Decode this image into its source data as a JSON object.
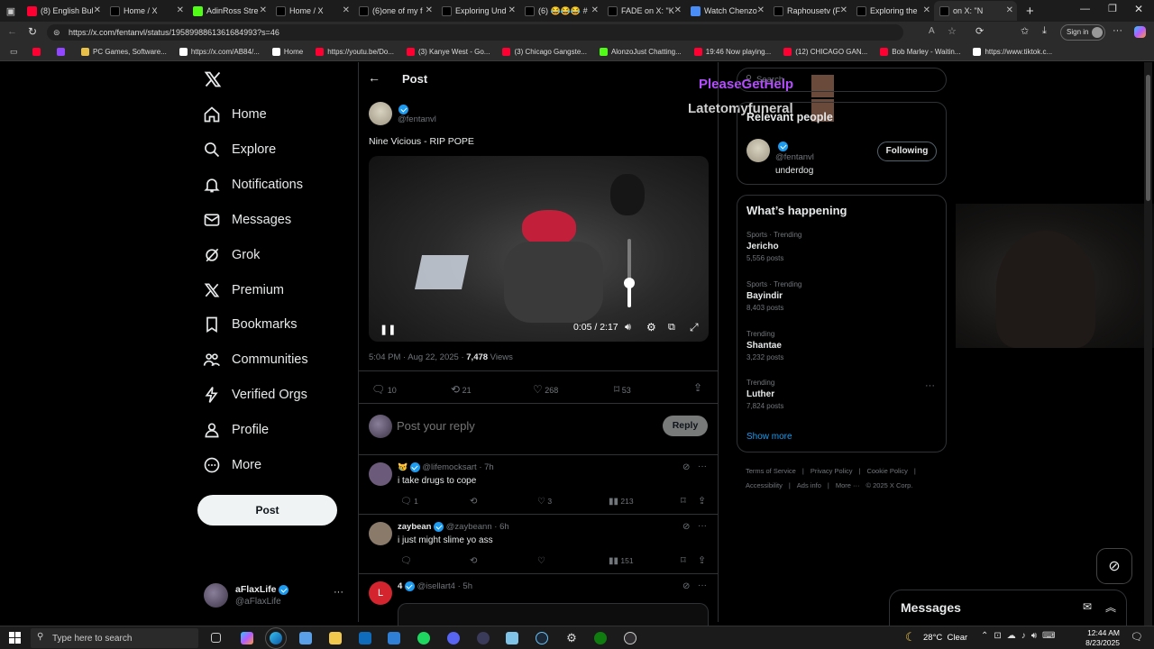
{
  "browser": {
    "tabs": [
      {
        "label": "(8) English Bul",
        "icon": "youtube-icon",
        "color": "#ff0033"
      },
      {
        "label": "Home / X",
        "icon": "x-icon",
        "color": "#ffffff"
      },
      {
        "label": "AdinRoss Stre",
        "icon": "kick-icon",
        "color": "#53fc18"
      },
      {
        "label": "Home / X",
        "icon": "x-icon",
        "color": "#ffffff"
      },
      {
        "label": "(6)one of my f",
        "icon": "tiktok-icon",
        "color": "#ffffff"
      },
      {
        "label": "Exploring Und",
        "icon": "tiktok-icon",
        "color": "#ffffff"
      },
      {
        "label": "(6) 😂😂😂 #",
        "icon": "tiktok-icon",
        "color": "#ffffff"
      },
      {
        "label": "FADE on X: \"K",
        "icon": "x-icon",
        "color": "#ffffff"
      },
      {
        "label": "Watch Chenzo",
        "icon": "globe-icon",
        "color": "#4a8df6"
      },
      {
        "label": "Raphousetv (F",
        "icon": "x-icon",
        "color": "#ffffff"
      },
      {
        "label": "Exploring the",
        "icon": "tiktok-icon",
        "color": "#ffffff"
      },
      {
        "label": "on X: \"N",
        "icon": "x-icon",
        "color": "#ffffff"
      }
    ],
    "url": "https://x.com/fentanvl/status/1958998861361684993?s=46",
    "signin": "Sign in",
    "bookmarks": [
      {
        "label": "",
        "color": "#ff0033"
      },
      {
        "label": "",
        "color": "#9146ff"
      },
      {
        "label": "PC Games, Software...",
        "color": "#e8c04a"
      },
      {
        "label": "https://x.com/AB84/...",
        "color": "#ffffff"
      },
      {
        "label": "Home",
        "color": "#ffffff"
      },
      {
        "label": "https://youtu.be/Do...",
        "color": "#ff0033"
      },
      {
        "label": "(3) Kanye West - Go...",
        "color": "#ff0033"
      },
      {
        "label": "(3) Chicago Gangste...",
        "color": "#ff0033"
      },
      {
        "label": "AlonzoJust Chatting...",
        "color": "#53fc18"
      },
      {
        "label": "19:46 Now playing...",
        "color": "#ff0033"
      },
      {
        "label": "(12) CHICAGO GAN...",
        "color": "#ff0033"
      },
      {
        "label": "Bob Marley - Waitin...",
        "color": "#ff0033"
      },
      {
        "label": "https://www.tiktok.c...",
        "color": "#ffffff"
      }
    ]
  },
  "nav": {
    "items": [
      {
        "label": "Home",
        "icon": "home-icon"
      },
      {
        "label": "Explore",
        "icon": "search-icon"
      },
      {
        "label": "Notifications",
        "icon": "bell-icon"
      },
      {
        "label": "Messages",
        "icon": "mail-icon"
      },
      {
        "label": "Grok",
        "icon": "grok-icon"
      },
      {
        "label": "Premium",
        "icon": "x-icon"
      },
      {
        "label": "Bookmarks",
        "icon": "bookmark-icon"
      },
      {
        "label": "Communities",
        "icon": "people-icon"
      },
      {
        "label": "Verified Orgs",
        "icon": "lightning-icon"
      },
      {
        "label": "Profile",
        "icon": "person-icon"
      },
      {
        "label": "More",
        "icon": "more-circle-icon"
      }
    ],
    "post_button": "Post",
    "account": {
      "name": "aFlaxLife",
      "handle": "@aFlaxLife"
    }
  },
  "post": {
    "header": "Post",
    "handle": "@fentanvl",
    "text": "Nine Vicious - RIP POPE",
    "video": {
      "time": "0:05 / 2:17",
      "volume": 0.35
    },
    "timestamp": "5:04 PM · Aug 22, 2025 · ",
    "views_count": "7,478",
    "views_label": " Views",
    "stats": {
      "replies": "10",
      "reposts": "21",
      "likes": "268",
      "bookmarks": "53"
    },
    "reply_placeholder": "Post your reply",
    "reply_button": "Reply"
  },
  "replies": [
    {
      "name": "",
      "handle": "@lifemocksart",
      "time": "· 7h",
      "text": "i take drugs to cope",
      "replies": "1",
      "reposts": "",
      "likes": "3",
      "views": "213",
      "avatar_color": "#6b5a7a",
      "initial": ""
    },
    {
      "name": "zaybean",
      "handle": "@zaybeann",
      "time": "· 6h",
      "text": "i just might slime yo ass",
      "replies": "",
      "reposts": "",
      "likes": "",
      "views": "151",
      "avatar_color": "#8a7a6a",
      "initial": ""
    },
    {
      "name": "4",
      "handle": "@isellart4",
      "time": "· 5h",
      "text": "",
      "replies": "",
      "reposts": "",
      "likes": "",
      "views": "",
      "avatar_color": "#d4252f",
      "initial": "L"
    }
  ],
  "overlay": {
    "line1": "PleaseGetHelp",
    "line2": "Latetomyfuneral"
  },
  "right": {
    "search_placeholder": "Search",
    "relevant_title": "Relevant people",
    "person": {
      "handle": "@fentanvl",
      "bio": "underdog",
      "button": "Following"
    },
    "happening_title": "What’s happening",
    "trends": [
      {
        "category": "Sports · Trending",
        "name": "Jericho",
        "count": "5,556 posts"
      },
      {
        "category": "Sports · Trending",
        "name": "Bayindir",
        "count": "8,403 posts"
      },
      {
        "category": "Trending",
        "name": "Shantae",
        "count": "3,232 posts"
      },
      {
        "category": "Trending",
        "name": "Luther",
        "count": "7,824 posts"
      }
    ],
    "show_more": "Show more",
    "footer": [
      "Terms of Service",
      "|",
      "Privacy Policy",
      "|",
      "Cookie Policy",
      "|",
      "Accessibility",
      "|",
      "Ads info",
      "|",
      "More ···",
      "© 2025 X Corp."
    ],
    "messages_title": "Messages"
  },
  "taskbar": {
    "search_placeholder": "Type here to search",
    "weather": "28°C  Clear",
    "time": "12:44 AM",
    "date": "8/23/2025"
  },
  "colors": {
    "accent": "#1d9bf0",
    "overlay_purple": "#b44dff"
  }
}
